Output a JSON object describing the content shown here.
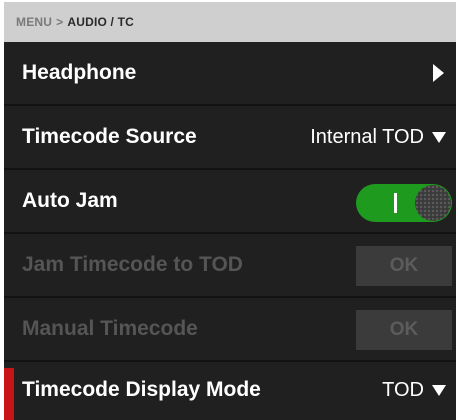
{
  "breadcrumb": {
    "root": "MENU",
    "separator": ">",
    "current": "AUDIO / TC"
  },
  "rows": {
    "headphone": {
      "label": "Headphone"
    },
    "timecode_source": {
      "label": "Timecode Source",
      "value": "Internal TOD"
    },
    "auto_jam": {
      "label": "Auto Jam",
      "state": "on"
    },
    "jam_timecode": {
      "label": "Jam Timecode to TOD",
      "button": "OK",
      "enabled": false
    },
    "manual_timecode": {
      "label": "Manual Timecode",
      "button": "OK",
      "enabled": false
    },
    "timecode_display_mode": {
      "label": "Timecode Display Mode",
      "value": "TOD"
    }
  },
  "icons": {
    "headphone_action": "chevron-right-icon",
    "dropdown": "caret-down-icon"
  },
  "colors": {
    "toggle_on": "#1e9a1e",
    "selection_indicator": "#c81414",
    "background": "#202020",
    "breadcrumb_bar": "#cfcfcf"
  }
}
